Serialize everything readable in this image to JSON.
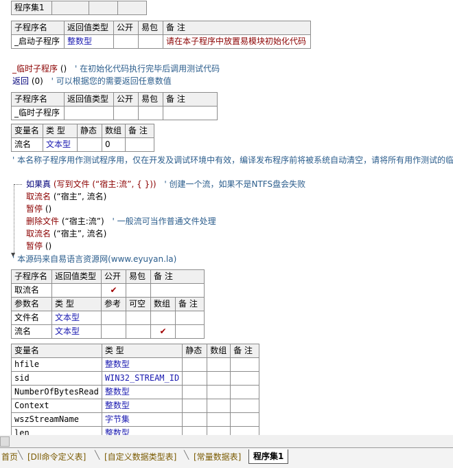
{
  "assembly_table": {
    "name": "程序集1",
    "cells": [
      "",
      "",
      ""
    ]
  },
  "sub1": {
    "headers": [
      "子程序名",
      "返回值类型",
      "公开",
      "易包",
      "备 注"
    ],
    "row": [
      "_启动子程序",
      "整数型",
      "",
      "",
      "请在本子程序中放置易模块初始化代码"
    ]
  },
  "code1": {
    "line1_name": "_临时子程序",
    "line1_parens": " ()",
    "line1_comment": "' 在初始化代码执行完毕后调用测试代码",
    "line2_kw": "返回",
    "line2_arg": " (0)",
    "line2_comment": "' 可以根据您的需要返回任意数值"
  },
  "sub2": {
    "headers": [
      "子程序名",
      "返回值类型",
      "公开",
      "易包",
      "备 注"
    ],
    "row": [
      "_临时子程序",
      "",
      "",
      "",
      ""
    ]
  },
  "vars2": {
    "headers": [
      "变量名",
      "类 型",
      "静态",
      "数组",
      "备 注"
    ],
    "row": [
      "流名",
      "文本型",
      "",
      "0",
      ""
    ]
  },
  "comment_long": "' 本名称子程序用作测试程序用，仅在开发及调试环境中有效，编译发布程序前将被系统自动清空，请将所有用作测试的临",
  "code2": {
    "if_kw": "如果真",
    "if_body": " (写到文件 (“宿主:流”, {  }))",
    "if_comment": "' 创建一个流，如果不是NTFS盘会失败",
    "l2_cmd": "取流名",
    "l2_args": " (“宿主”, 流名)",
    "l3_cmd": "暂停",
    "l3_args": " ()",
    "l4_cmd": "删除文件",
    "l4_args": " (“宿主:流”)",
    "l4_comment": "' 一般流可当作普通文件处理",
    "l5_cmd": "取流名",
    "l5_args": " (“宿主”, 流名)",
    "l6_cmd": "暂停",
    "l6_args": " ()",
    "source_comment": "' 本源码来自易语言资源网(www.eyuyan.la)"
  },
  "sub3": {
    "headers": [
      "子程序名",
      "返回值类型",
      "公开",
      "易包",
      "备 注"
    ],
    "row": [
      "取流名",
      "",
      "✔",
      "",
      ""
    ],
    "param_headers": [
      "参数名",
      "类 型",
      "参考",
      "可空",
      "数组",
      "备 注"
    ],
    "params": [
      [
        "文件名",
        "文本型",
        "",
        "",
        "",
        ""
      ],
      [
        "流名",
        "文本型",
        "",
        "",
        "✔",
        ""
      ]
    ]
  },
  "vars3": {
    "headers": [
      "变量名",
      "类 型",
      "静态",
      "数组",
      "备 注"
    ],
    "rows": [
      [
        "hfile",
        "整数型",
        "",
        "",
        ""
      ],
      [
        "sid",
        "WIN32_STREAM_ID",
        "",
        "",
        ""
      ],
      [
        "NumberOfBytesRead",
        "整数型",
        "",
        "",
        ""
      ],
      [
        "Context",
        "整数型",
        "",
        "",
        ""
      ],
      [
        "wszStreamName",
        "字节集",
        "",
        "",
        ""
      ],
      [
        "len",
        "整数型",
        "",
        "",
        ""
      ]
    ]
  },
  "tabs": [
    "首页",
    "[Dll命令定义表]",
    "[自定义数据类型表]",
    "[常量数据表]",
    "程序集1"
  ]
}
